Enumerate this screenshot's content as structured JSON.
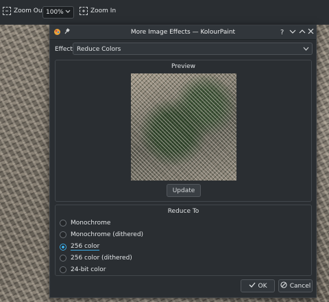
{
  "toolbar": {
    "zoom_out_label": "Zoom Out",
    "zoom_value": "100%",
    "zoom_in_label": "Zoom In"
  },
  "dialog": {
    "title": "More Image Effects — KolourPaint",
    "effect_label": "Effect:",
    "effect_value": "Reduce Colors",
    "preview_title": "Preview",
    "update_label": "Update",
    "reduce_title": "Reduce To",
    "options": [
      {
        "label": "Monochrome",
        "checked": false
      },
      {
        "label": "Monochrome (dithered)",
        "checked": false
      },
      {
        "label": "256 color",
        "checked": true
      },
      {
        "label": "256 color (dithered)",
        "checked": false
      },
      {
        "label": "24-bit color",
        "checked": false
      }
    ],
    "ok_label": "OK",
    "cancel_label": "Cancel"
  },
  "colors": {
    "accent": "#3daee9",
    "window_bg": "#2a2e32",
    "titlebar_bg": "#31363b"
  }
}
